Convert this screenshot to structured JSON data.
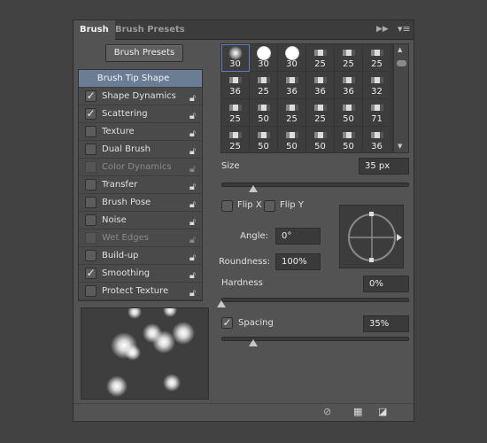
{
  "tabs": [
    {
      "label": "Brush",
      "active": true
    },
    {
      "label": "Brush Presets",
      "active": false
    }
  ],
  "header_icons": [
    "double-arrow-icon",
    "panel-menu-icon"
  ],
  "brush_presets_button": "Brush Presets",
  "options": [
    {
      "label": "Brush Tip Shape",
      "selected": true
    },
    {
      "label": "Shape Dynamics",
      "checked": true,
      "enabled": true
    },
    {
      "label": "Scattering",
      "checked": true,
      "enabled": true
    },
    {
      "label": "Texture",
      "checked": false,
      "enabled": true
    },
    {
      "label": "Dual Brush",
      "checked": false,
      "enabled": true
    },
    {
      "label": "Color Dynamics",
      "checked": false,
      "enabled": false
    },
    {
      "label": "Transfer",
      "checked": false,
      "enabled": true
    },
    {
      "label": "Brush Pose",
      "checked": false,
      "enabled": true
    },
    {
      "label": "Noise",
      "checked": false,
      "enabled": true
    },
    {
      "label": "Wet Edges",
      "checked": false,
      "enabled": false
    },
    {
      "label": "Build-up",
      "checked": false,
      "enabled": true
    },
    {
      "label": "Smoothing",
      "checked": true,
      "enabled": true
    },
    {
      "label": "Protect Texture",
      "checked": false,
      "enabled": true
    }
  ],
  "brushes": [
    "30",
    "30",
    "30",
    "25",
    "25",
    "25",
    "36",
    "25",
    "36",
    "36",
    "36",
    "32",
    "25",
    "50",
    "25",
    "25",
    "50",
    "71",
    "25",
    "50",
    "50",
    "50",
    "50",
    "36"
  ],
  "size": {
    "label": "Size",
    "value": "35 px",
    "slider": 0.17
  },
  "flip_x": {
    "label": "Flip X",
    "checked": false
  },
  "flip_y": {
    "label": "Flip Y",
    "checked": false
  },
  "angle": {
    "label": "Angle:",
    "value": "0°"
  },
  "roundness": {
    "label": "Roundness:",
    "value": "100%"
  },
  "hardness": {
    "label": "Hardness",
    "value": "0%",
    "slider": 0
  },
  "spacing": {
    "label": "Spacing",
    "value": "35%",
    "checked": true,
    "slider": 0.17
  },
  "footer_icons": [
    "toggle-preview-icon",
    "grid-icon",
    "new-preset-icon"
  ]
}
